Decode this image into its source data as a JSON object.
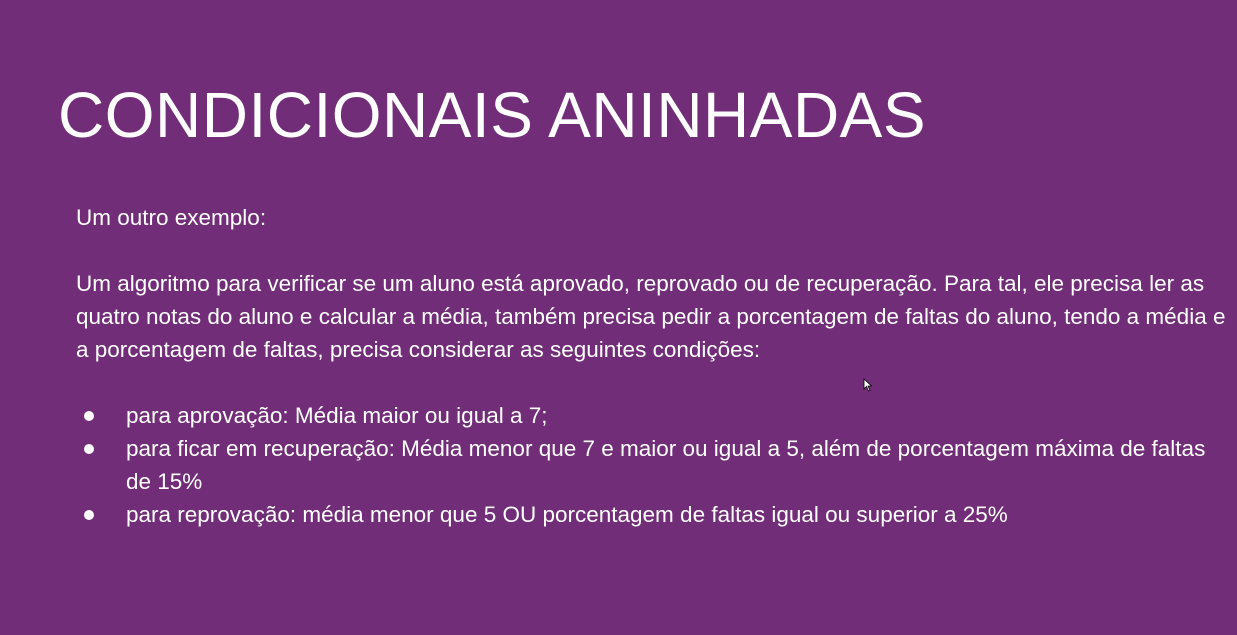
{
  "slide": {
    "title": "CONDICIONAIS ANINHADAS",
    "intro": "Um outro exemplo:",
    "paragraph": "Um algoritmo para verificar se um aluno está aprovado, reprovado ou de recuperação. Para tal, ele precisa ler as quatro notas do aluno e calcular a média, também precisa pedir a porcentagem de faltas do aluno, tendo a média e a porcentagem de faltas, precisa considerar as seguintes condições:",
    "bullets": [
      "para aprovação: Média maior ou igual a 7;",
      "para ficar em recuperação: Média menor que 7 e maior ou igual a 5, além de porcentagem máxima de faltas de 15%",
      "para reprovação: média menor que 5 OU porcentagem de faltas igual ou superior a 25%"
    ]
  },
  "colors": {
    "background": "#722d78",
    "text": "#ffffff"
  },
  "icons": {
    "cursor": "mouse-pointer-icon"
  }
}
